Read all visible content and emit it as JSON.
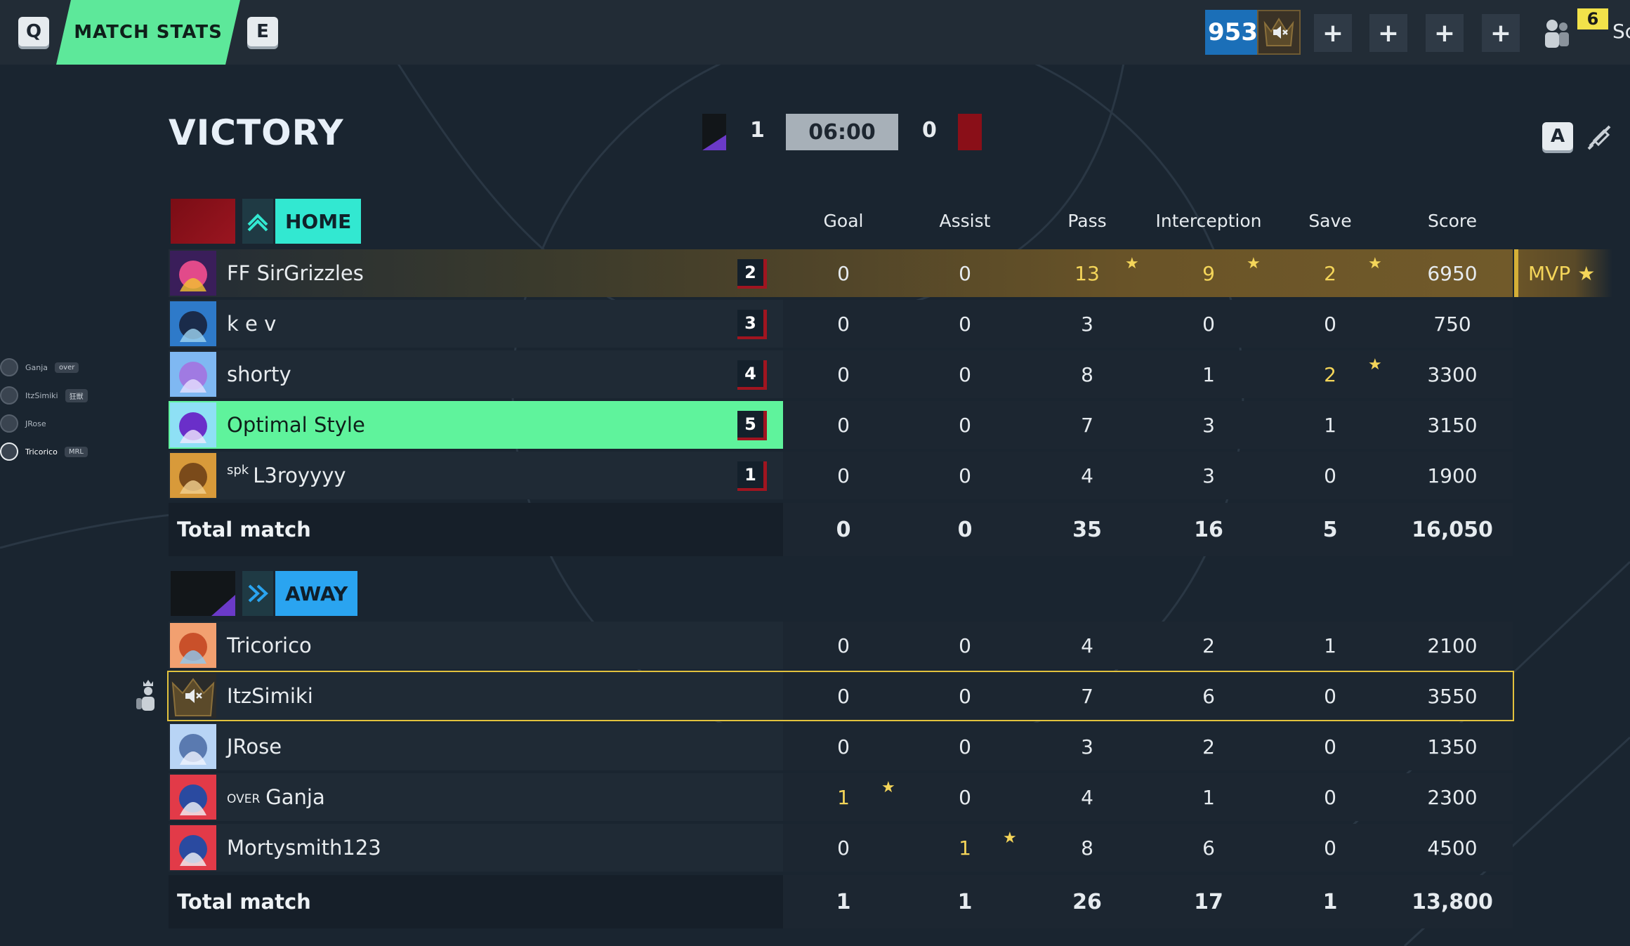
{
  "topbar": {
    "key_left": "Q",
    "tab_label": "MATCH STATS",
    "key_right": "E",
    "coins": "953",
    "friends_count": "6",
    "corner_text": "Sc",
    "plus_label": "+"
  },
  "header": {
    "result": "VICTORY",
    "home_score": "1",
    "timer": "06:00",
    "away_score": "0",
    "key_a": "A"
  },
  "columns": [
    "Goal",
    "Assist",
    "Pass",
    "Interception",
    "Save",
    "Score"
  ],
  "home": {
    "name": "HOME",
    "color": "#8a0f18",
    "accent": "#32e8d1",
    "players": [
      {
        "tag": "",
        "name": "FF SirGrizzles",
        "rank": "2",
        "stats": [
          "0",
          "0",
          "13",
          "9",
          "2",
          "6950"
        ],
        "gold": [
          false,
          false,
          true,
          true,
          true,
          false
        ],
        "mvp": true
      },
      {
        "tag": "",
        "name": "k e v",
        "rank": "3",
        "stats": [
          "0",
          "0",
          "3",
          "0",
          "0",
          "750"
        ],
        "gold": [
          false,
          false,
          false,
          false,
          false,
          false
        ]
      },
      {
        "tag": "",
        "name": "shorty",
        "rank": "4",
        "stats": [
          "0",
          "0",
          "8",
          "1",
          "2",
          "3300"
        ],
        "gold": [
          false,
          false,
          false,
          false,
          true,
          false
        ]
      },
      {
        "tag": "",
        "name": "Optimal Style",
        "rank": "5",
        "stats": [
          "0",
          "0",
          "7",
          "3",
          "1",
          "3150"
        ],
        "gold": [
          false,
          false,
          false,
          false,
          false,
          false
        ],
        "highlight": true
      },
      {
        "tag": "spk",
        "name": "L3royyyy",
        "rank": "1",
        "stats": [
          "0",
          "0",
          "4",
          "3",
          "0",
          "1900"
        ],
        "gold": [
          false,
          false,
          false,
          false,
          false,
          false
        ]
      }
    ],
    "total_label": "Total match",
    "totals": [
      "0",
      "0",
      "35",
      "16",
      "5",
      "16,050"
    ]
  },
  "away": {
    "name": "AWAY",
    "accent": "#2aa4f0",
    "players": [
      {
        "tag": "",
        "name": "Tricorico",
        "stats": [
          "0",
          "0",
          "4",
          "2",
          "1",
          "2100"
        ]
      },
      {
        "tag": "",
        "name": "ItzSimiki",
        "stats": [
          "0",
          "0",
          "7",
          "6",
          "0",
          "3550"
        ],
        "selected": true
      },
      {
        "tag": "",
        "name": "JRose",
        "stats": [
          "0",
          "0",
          "3",
          "2",
          "0",
          "1350"
        ]
      },
      {
        "tag": "over",
        "name": "Ganja",
        "stats": [
          "1",
          "0",
          "4",
          "1",
          "0",
          "2300"
        ],
        "gold": [
          true,
          false,
          false,
          false,
          false,
          false
        ]
      },
      {
        "tag": "",
        "name": "Mortysmith123",
        "stats": [
          "0",
          "1",
          "8",
          "6",
          "0",
          "4500"
        ],
        "gold": [
          false,
          true,
          false,
          false,
          false,
          false
        ]
      }
    ],
    "total_label": "Total match",
    "totals": [
      "1",
      "1",
      "26",
      "17",
      "1",
      "13,800"
    ]
  },
  "mvp_label": "MVP",
  "side_list": [
    {
      "name": "Ganja",
      "badge": "over"
    },
    {
      "name": "ItzSimiki",
      "badge": "狂獣"
    },
    {
      "name": "JRose",
      "badge": ""
    },
    {
      "name": "Tricorico",
      "badge": "MRL",
      "current": true
    }
  ]
}
